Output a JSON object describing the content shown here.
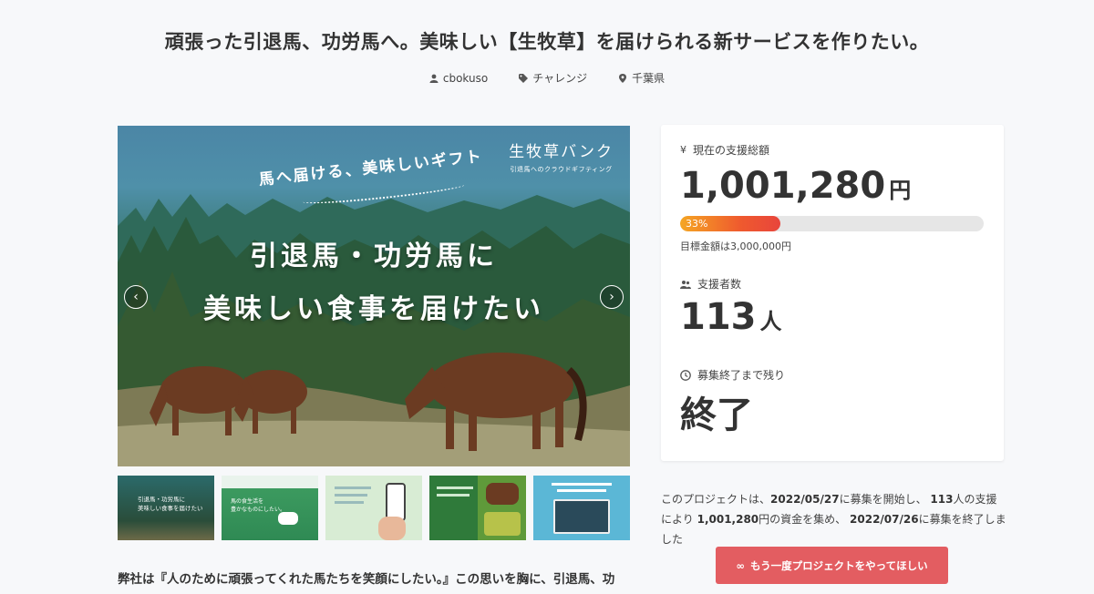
{
  "project": {
    "title": "頑張った引退馬、功労馬へ。美味しい【生牧草】を届けられる新サービスを作りたい。",
    "author": "cbokuso",
    "category": "チャレンジ",
    "location": "千葉県"
  },
  "hero": {
    "brand_name": "生牧草バンク",
    "brand_sub": "引退馬へのクラウドギフティング",
    "arc_text": "馬へ届ける、美味しいギフト",
    "headline_1": "引退馬・功労馬に",
    "headline_2": "美味しい食事を届けたい",
    "prev_symbol": "‹",
    "next_symbol": "›"
  },
  "thumbnails": [
    {
      "lines": [
        "引退馬・功労馬に",
        "美味しい食事を届けたい"
      ],
      "color": "#2f5e4b"
    },
    {
      "lines": [
        "馬の食生活を",
        "豊かなものにしたい。"
      ],
      "color": "#2f9a5e"
    },
    {
      "lines": [],
      "color": "#d8ecd4"
    },
    {
      "lines": [],
      "color": "#3b7a3f"
    },
    {
      "lines": [],
      "color": "#5bb7d6"
    }
  ],
  "lead_text": "弊社は『人のために頑張ってくれた馬たちを笑顔にしたい。』この思いを胸に、引退馬、功",
  "stats": {
    "raised_label": "現在の支援総額",
    "raised_value": "1,001,280",
    "raised_unit": "円",
    "progress_percent": 33,
    "progress_label": "33%",
    "goal_text": "目標金額は3,000,000円",
    "backers_label": "支援者数",
    "backers_value": "113",
    "backers_unit": "人",
    "remaining_label": "募集終了まで残り",
    "remaining_value": "終了"
  },
  "summary": {
    "prefix": "このプロジェクトは、",
    "start_date": "2022/05/27",
    "mid1": "に募集を開始し、",
    "backers": "113",
    "mid2": "人の支援により",
    "amount": "1,001,280",
    "mid3": "円の資金を集め、",
    "end_date": "2022/07/26",
    "suffix": "に募集を終了しました"
  },
  "cta": {
    "icon": "∞",
    "label": "もう一度プロジェクトをやってほしい"
  },
  "colors": {
    "accent": "#e35d61",
    "progress_start": "#f5a623",
    "progress_end": "#e8453c"
  }
}
